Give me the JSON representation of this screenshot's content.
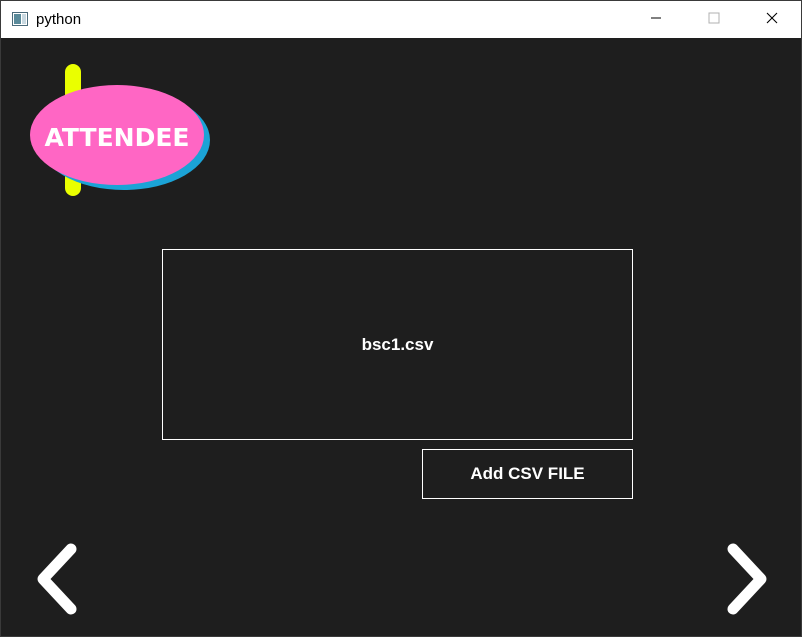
{
  "window": {
    "title": "python",
    "icon": "app-window-icon",
    "controls": [
      "minimize-icon",
      "maximize-icon",
      "close-icon"
    ]
  },
  "logo": {
    "text": "ATTENDEE",
    "colors": {
      "pink": "#ff66c4",
      "blue": "#1ba3d6",
      "yellow": "#eaff00"
    }
  },
  "file_panel": {
    "file_name": "bsc1.csv"
  },
  "actions": {
    "add_csv_label": "Add CSV FILE"
  },
  "navigation": {
    "prev_icon": "chevron-left-icon",
    "next_icon": "chevron-right-icon"
  },
  "colors": {
    "background": "#1e1e1e",
    "foreground": "#ffffff"
  }
}
